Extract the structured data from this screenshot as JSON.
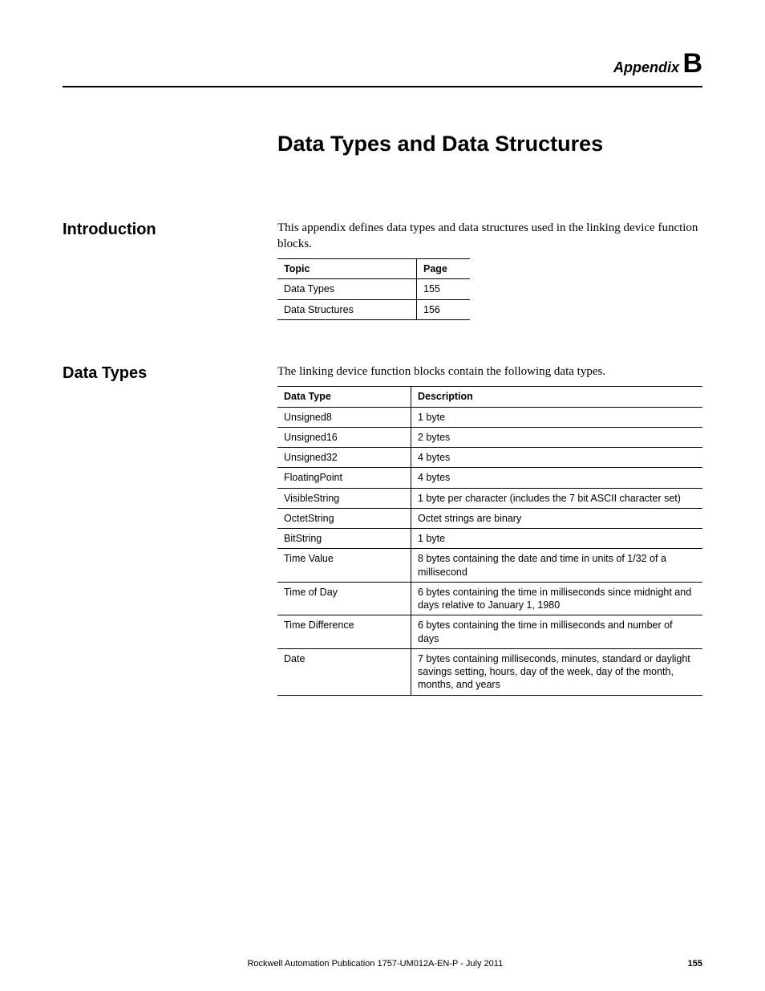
{
  "header": {
    "appendix_label": "Appendix",
    "appendix_letter": "B"
  },
  "chapter_title": "Data Types and Data Structures",
  "intro": {
    "heading": "Introduction",
    "paragraph": "This appendix defines data types and data structures used in the linking device function blocks.",
    "topic_table": {
      "headers": {
        "topic": "Topic",
        "page": "Page"
      },
      "rows": [
        {
          "topic": "Data Types",
          "page": "155"
        },
        {
          "topic": "Data Structures",
          "page": "156"
        }
      ]
    }
  },
  "datatypes": {
    "heading": "Data Types",
    "paragraph": "The linking device function blocks contain the following data types.",
    "table": {
      "headers": {
        "type": "Data Type",
        "desc": "Description"
      },
      "rows": [
        {
          "type": "Unsigned8",
          "desc": "1 byte"
        },
        {
          "type": "Unsigned16",
          "desc": "2 bytes"
        },
        {
          "type": "Unsigned32",
          "desc": "4 bytes"
        },
        {
          "type": "FloatingPoint",
          "desc": "4 bytes"
        },
        {
          "type": "VisibleString",
          "desc": "1 byte per character (includes the 7 bit ASCII character set)"
        },
        {
          "type": "OctetString",
          "desc": "Octet strings are binary"
        },
        {
          "type": "BitString",
          "desc": "1 byte"
        },
        {
          "type": "Time Value",
          "desc": "8 bytes containing the date and time in units of 1/32 of a millisecond"
        },
        {
          "type": "Time of Day",
          "desc": "6 bytes containing the time in milliseconds since midnight and days relative to January 1, 1980"
        },
        {
          "type": "Time Difference",
          "desc": "6 bytes containing the time in milliseconds and number of days"
        },
        {
          "type": "Date",
          "desc": "7 bytes containing milliseconds, minutes, standard or daylight savings setting, hours, day of the week, day of the month, months, and years"
        }
      ]
    }
  },
  "footer": {
    "publication": "Rockwell Automation Publication 1757-UM012A-EN-P - July 2011",
    "page": "155"
  }
}
